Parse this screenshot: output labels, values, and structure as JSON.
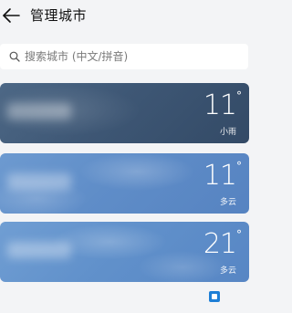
{
  "header": {
    "title": "管理城市",
    "back_icon": "arrow-left-icon"
  },
  "search": {
    "placeholder": "搜索城市 (中文/拼音)",
    "icon": "search-icon"
  },
  "cities": [
    {
      "temp": "11",
      "degree": "°",
      "condition": "小雨"
    },
    {
      "temp": "11",
      "degree": "°",
      "condition": "多云"
    },
    {
      "temp": "21",
      "degree": "°",
      "condition": "多云"
    }
  ],
  "colors": {
    "card_rain": "#3e5775",
    "card_cloudy": "#5f8dc8",
    "background": "#f3f4f6"
  }
}
